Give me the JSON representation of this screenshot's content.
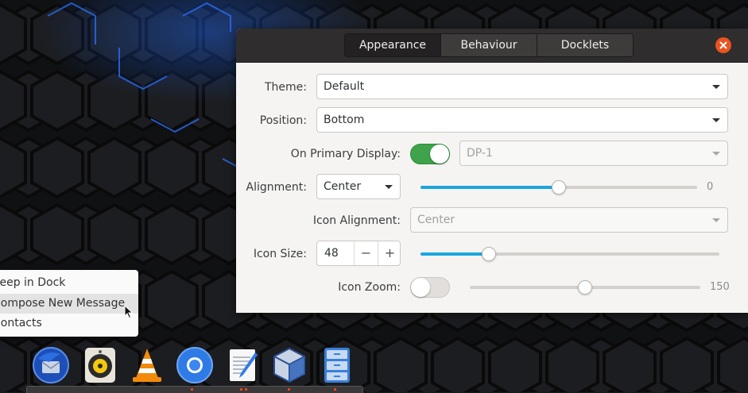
{
  "window": {
    "tabs": [
      {
        "label": "Appearance",
        "active": true
      },
      {
        "label": "Behaviour",
        "active": false
      },
      {
        "label": "Docklets",
        "active": false
      }
    ],
    "close_icon": "close-icon"
  },
  "settings": {
    "theme": {
      "label": "Theme:",
      "value": "Default"
    },
    "position": {
      "label": "Position:",
      "value": "Bottom"
    },
    "primary_display": {
      "label": "On Primary Display:",
      "enabled": true,
      "value": "DP-1"
    },
    "alignment": {
      "label": "Alignment:",
      "value": "Center",
      "offset_value": "0",
      "offset_fraction": 0.5
    },
    "icon_alignment": {
      "label": "Icon Alignment:",
      "value": "Center"
    },
    "icon_size": {
      "label": "Icon Size:",
      "value": "48",
      "minus": "−",
      "plus": "+",
      "slider_fraction": 0.23
    },
    "icon_zoom": {
      "label": "Icon Zoom:",
      "enabled": false,
      "value": "150",
      "slider_fraction": 0.5
    }
  },
  "context_menu": {
    "items": [
      "Keep in Dock",
      "Compose New Message",
      "Contacts"
    ],
    "hovered_index": 1
  },
  "dock": {
    "icons": [
      "thunderbird-icon",
      "rhythmbox-icon",
      "vlc-icon",
      "chromium-icon",
      "text-editor-icon",
      "virtualbox-icon",
      "file-cabinet-icon"
    ]
  },
  "colors": {
    "accent": "#1aa6de",
    "switch_on": "#3ea34b",
    "close": "#e95420",
    "titlebar": "#2f2d2d"
  }
}
